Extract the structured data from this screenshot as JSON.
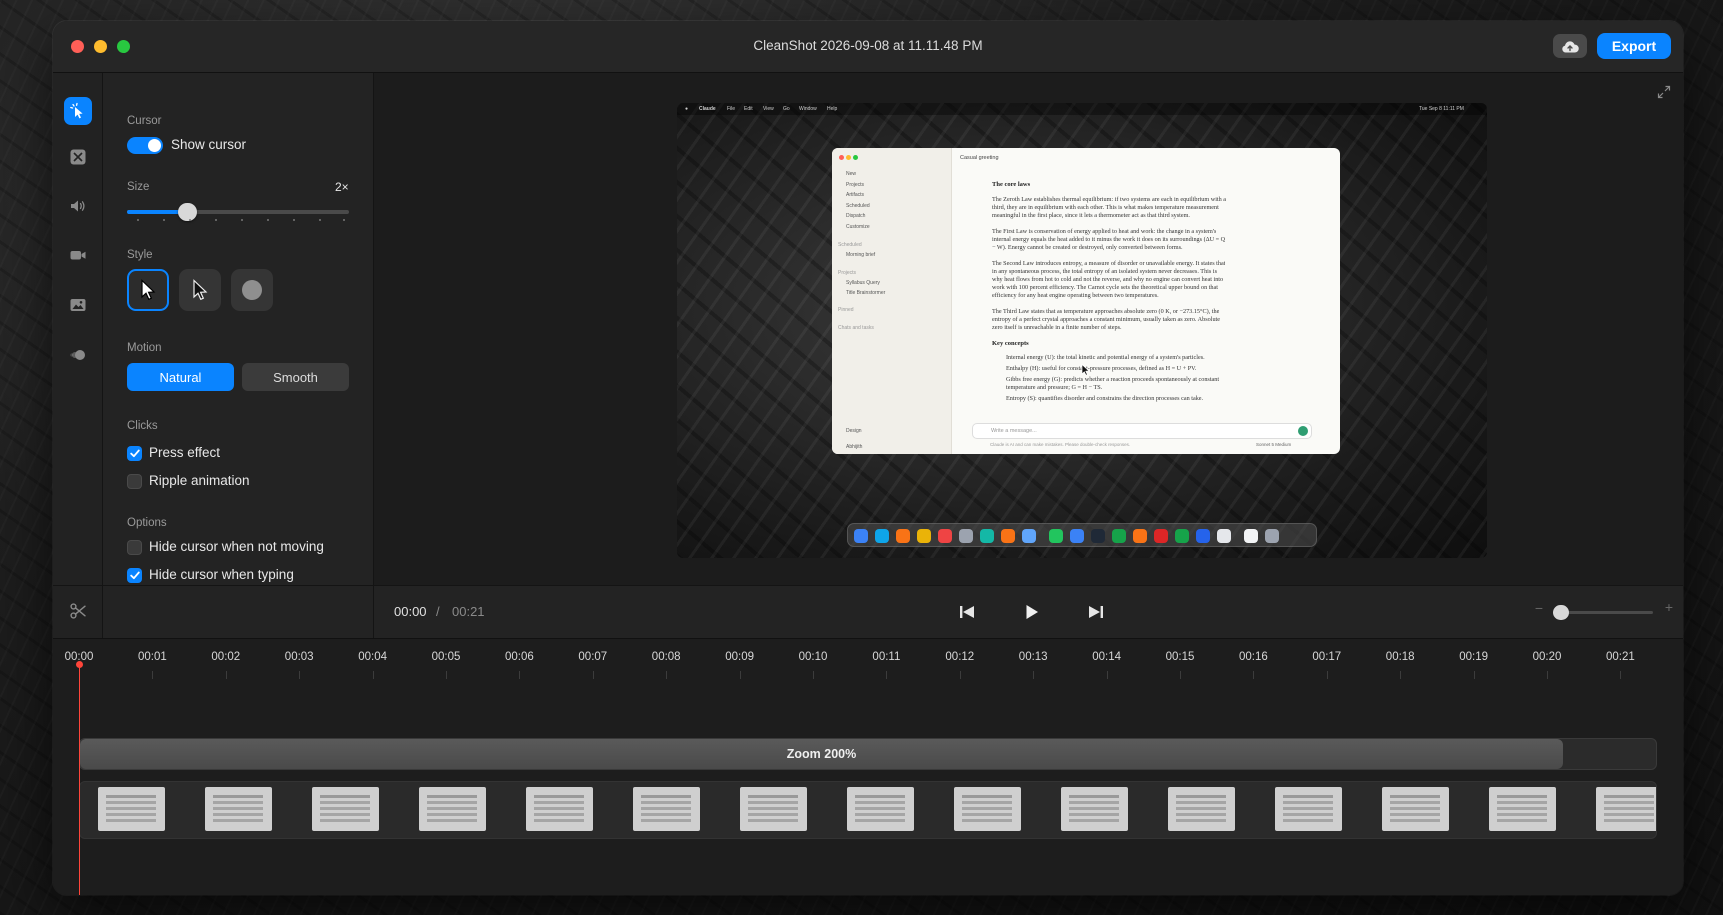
{
  "window": {
    "title": "CleanShot 2026-09-08 at 11.11.48 PM",
    "export_label": "Export",
    "accent": "#0a84ff"
  },
  "rail": {
    "items": [
      "cursor-icon",
      "background-icon",
      "audio-icon",
      "camera-icon",
      "image-icon",
      "motion-icon"
    ],
    "bottom": "scissors-icon"
  },
  "panel": {
    "cursor_title": "Cursor",
    "show_cursor_label": "Show cursor",
    "show_cursor_on": true,
    "size_title": "Size",
    "size_value": "2×",
    "size_level": 0.25,
    "style_title": "Style",
    "style_options": [
      "arrow-outlined",
      "arrow-dark",
      "circle"
    ],
    "style_selected": 0,
    "motion_title": "Motion",
    "motion_natural": "Natural",
    "motion_smooth": "Smooth",
    "motion_selected": "Natural",
    "clicks_title": "Clicks",
    "press_effect_label": "Press effect",
    "press_effect_on": true,
    "ripple_label": "Ripple animation",
    "ripple_on": false,
    "options_title": "Options",
    "hide_not_moving_label": "Hide cursor when not moving",
    "hide_not_moving_on": false,
    "hide_typing_label": "Hide cursor when typing",
    "hide_typing_on": true
  },
  "preview": {
    "menubar": [
      "Claude",
      "File",
      "Edit",
      "View",
      "Go",
      "Window",
      "Help"
    ],
    "clock": "Tue Sep 8  11:11 PM",
    "app": {
      "chat_title": "Casual greeting",
      "sidebar": [
        "New",
        "Projects",
        "Artifacts",
        "Scheduled",
        "Dispatch",
        "Customize",
        "Scheduled",
        "Morning brief",
        "Projects",
        "Syllabus Query",
        "Title Brainstormer",
        "Pinned",
        "Chats and tasks",
        "Design",
        "Abhijith"
      ],
      "heading_core": "The core laws",
      "p1": "The Zeroth Law establishes thermal equilibrium: if two systems are each in equilibrium with a",
      "p1b": "third, they are in equilibrium with each other. This is what makes temperature measurement",
      "p1c": "meaningful in the first place, since it lets a thermometer act as that third system.",
      "p2": "The First Law is conservation of energy applied to heat and work: the change in a system's",
      "p2b": "internal energy equals the heat added to it minus the work it does on its surroundings (ΔU = Q",
      "p2c": "− W). Energy cannot be created or destroyed, only converted between forms.",
      "p3": "The Second Law introduces entropy, a measure of disorder or unavailable energy. It states that",
      "p3b": "in any spontaneous process, the total entropy of an isolated system never decreases. This is",
      "p3c": "why heat flows from hot to cold and not the reverse, and why no engine can convert heat into",
      "p3d": "work with 100 percent efficiency. The Carnot cycle sets the theoretical upper bound on that",
      "p3e": "efficiency for any heat engine operating between two temperatures.",
      "p4": "The Third Law states that as temperature approaches absolute zero (0 K, or −273.15°C), the",
      "p4b": "entropy of a perfect crystal approaches a constant minimum, usually taken as zero. Absolute",
      "p4c": "zero itself is unreachable in a finite number of steps.",
      "heading_key": "Key concepts",
      "b1": "Internal energy (U): the total kinetic and potential energy of a system's particles.",
      "b2": "Enthalpy (H): useful for constant-pressure processes, defined as H = U + PV.",
      "b3": "Gibbs free energy (G): predicts whether a reaction proceeds spontaneously at constant",
      "b3b": "temperature and pressure; G = H − TS.",
      "b4": "Entropy (S): quantifies disorder and constrains the direction processes can take.",
      "input_placeholder": "Write a message...",
      "disclaimer": "Claude is AI and can make mistakes. Please double-check responses.",
      "model": "Sonnet 5  Medium"
    }
  },
  "transport": {
    "current": "00:00",
    "separator": "/",
    "total": "00:21",
    "zoom_minus": "−",
    "zoom_plus": "+"
  },
  "timeline": {
    "ruler": [
      "00:00",
      "00:01",
      "00:02",
      "00:03",
      "00:04",
      "00:05",
      "00:06",
      "00:07",
      "00:08",
      "00:09",
      "00:10",
      "00:11",
      "00:12",
      "00:13",
      "00:14",
      "00:15",
      "00:16",
      "00:17",
      "00:18",
      "00:19",
      "00:20",
      "00:21"
    ],
    "zoom_segment_label": "Zoom 200%",
    "thumbnail_count": 15,
    "playhead_color": "#ff453a"
  }
}
